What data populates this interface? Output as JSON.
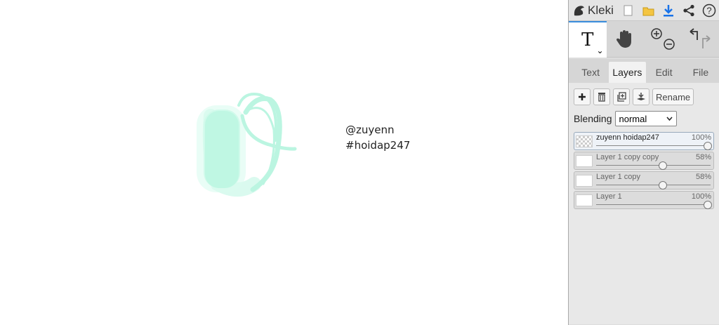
{
  "canvas": {
    "text_lines": [
      "@zuyenn",
      "#hoidap247"
    ],
    "stroke_color": "#b8f5e0"
  },
  "app": {
    "name": "Kleki"
  },
  "topbar": {
    "icons": [
      "new-file-icon",
      "open-folder-icon",
      "download-icon",
      "share-icon",
      "help-icon"
    ]
  },
  "tools": {
    "text_tool_glyph": "T",
    "chevron": "⌄"
  },
  "tabs": [
    "Text",
    "Layers",
    "Edit",
    "File"
  ],
  "active_tab": "Layers",
  "layers_panel": {
    "rename_label": "Rename",
    "blending_label": "Blending",
    "blending_value": "normal",
    "layers": [
      {
        "name": "zuyenn hoidap247",
        "opacity_label": "100%",
        "opacity": 1.0,
        "selected": true
      },
      {
        "name": "Layer 1 copy copy",
        "opacity_label": "58%",
        "opacity": 0.58,
        "selected": false
      },
      {
        "name": "Layer 1 copy",
        "opacity_label": "58%",
        "opacity": 0.58,
        "selected": false
      },
      {
        "name": "Layer 1",
        "opacity_label": "100%",
        "opacity": 1.0,
        "selected": false
      }
    ]
  }
}
